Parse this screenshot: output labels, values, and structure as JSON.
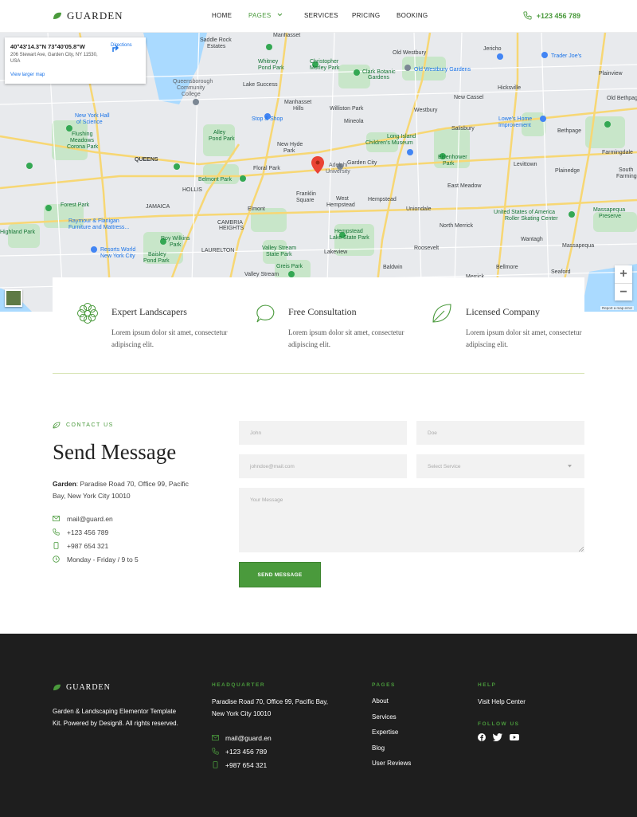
{
  "brand": {
    "name": "GUARDEN",
    "accent": "#4a9a3c"
  },
  "nav": {
    "items": [
      "HOME",
      "PAGES",
      "SERVICES",
      "PRICING",
      "BOOKING"
    ],
    "active": "PAGES",
    "phone": "+123 456 789"
  },
  "map": {
    "coords": "40°43'14.3\"N 73°40'05.8\"W",
    "address": "206 Stewart Ave, Garden City, NY 11530, USA",
    "directions": "Directions",
    "larger": "View larger map",
    "attribution": "Report a map error",
    "labels": [
      "Saddle Rock Estates",
      "Manhasset",
      "Old Westbury",
      "Jericho",
      "Trader Joe's",
      "Plainview",
      "Queensborough Community College",
      "Lake Success",
      "Christopher Morley Park",
      "Clark Botanic Garden",
      "Old Westbury Gardens",
      "Hicksville",
      "New York Hall of Science",
      "Manhasset Hills",
      "Williston Park",
      "New Cassel",
      "Old Bethpage",
      "Flushing Meadows Corona Park",
      "Alley Pond Park",
      "Stop & Shop",
      "Mineola",
      "Westbury",
      "Salisbury",
      "Bethpage",
      "Lowe's Home Improvement",
      "New Hyde Park",
      "Long Island Children's Museum",
      "Farmingdale",
      "Queens",
      "Floral Park",
      "Garden City",
      "Eisenhower Park",
      "Levittown",
      "Belmont Park",
      "Adelphi University",
      "Plainedge",
      "South Farmingdale",
      "Franklin Square",
      "West Hempstead",
      "Hempstead",
      "East Meadow",
      "Elmont",
      "Uniondale",
      "United States of America Roller Skating Center",
      "Massapequa Preserve",
      "Forest Park",
      "North Merrick",
      "Raymour & Flanigan Furniture and Mattress",
      "Hempstead Lake State Park",
      "Wantagh",
      "Massapequa",
      "Roy Wilkins Park",
      "Valley Stream State Park",
      "Roosevelt",
      "Resorts World New York City",
      "Baisley Pond Park",
      "Lakeview",
      "Baldwin",
      "Bellmore",
      "Seaford",
      "Valley Stream",
      "Greis Park",
      "Merrick",
      "Jamaica",
      "Cambria Heights",
      "Hollis",
      "Laurelton",
      "Highland Park"
    ]
  },
  "features": [
    {
      "title": "Expert Landscapers",
      "desc": "Lorem ipsum dolor sit amet, consectetur adipiscing elit.",
      "icon": "flower-icon"
    },
    {
      "title": "Free Consultation",
      "desc": "Lorem ipsum dolor sit amet, consectetur adipiscing elit.",
      "icon": "chat-icon"
    },
    {
      "title": "Licensed Company",
      "desc": "Lorem ipsum dolor sit amet, consectetur adipiscing elit.",
      "icon": "leaf-icon"
    }
  ],
  "contact": {
    "tag": "CONTACT US",
    "title": "Send Message",
    "addr_label": "Garden",
    "addr_text": ": Paradise Road 70, Office 99, Pacific Bay, New York City 10010",
    "email": "mail@guard.en",
    "phone": "+123 456 789",
    "mobile": "+987 654 321",
    "hours": "Monday - Friday / 9 to 5"
  },
  "form": {
    "first_name": "John",
    "last_name": "Doe",
    "email": "johndoe@mail.com",
    "service": "Select Service",
    "message": "Your Message",
    "submit": "SEND MESSAGE"
  },
  "footer": {
    "brand": "GUARDEN",
    "desc": "Garden & Landscaping Elementor Template Kit. Powered by Design8. All rights reserved.",
    "hq_head": "HEADQUARTER",
    "hq_addr": "Paradise Road 70, Office 99, Pacific Bay,  New York City 10010",
    "email": "mail@guard.en",
    "phone": "+123 456 789",
    "mobile": "+987 654 321",
    "pages_head": "PAGES",
    "pages": [
      "About",
      "Services",
      "Expertise",
      "Blog",
      "User Reviews"
    ],
    "help_head": "HELP",
    "help_link": "Visit Help Center",
    "follow_head": "FOLLOW US",
    "social": [
      "facebook-icon",
      "twitter-icon",
      "youtube-icon"
    ]
  }
}
